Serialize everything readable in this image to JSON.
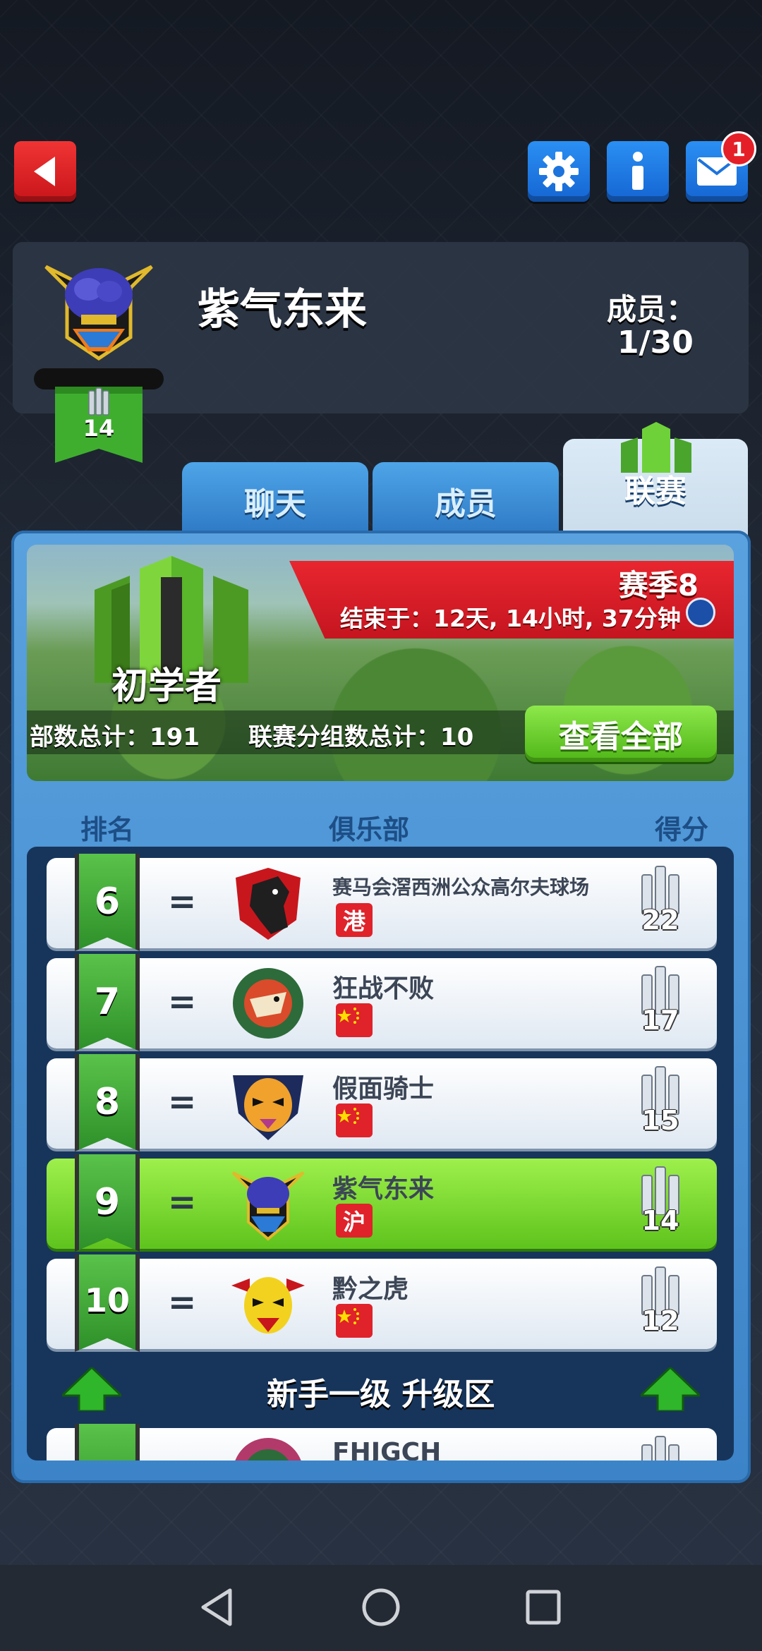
{
  "header": {
    "mail_count": "1"
  },
  "club": {
    "name": "紫气东来",
    "members_label": "成员：",
    "members_value": "1/30",
    "level": "14"
  },
  "tabs": [
    {
      "label": "聊天"
    },
    {
      "label": "成员"
    },
    {
      "label": "联赛"
    }
  ],
  "league": {
    "season": "赛季8",
    "ends_in": "结束于：12天, 14小时, 37分钟",
    "tier": "初学者",
    "clubs_total": "部数总计：191",
    "groups_total": "联赛分组数总计：10",
    "view_all": "查看全部"
  },
  "table": {
    "columns": [
      "排名",
      "俱乐部",
      "得分"
    ],
    "rows": [
      {
        "rank": "6",
        "change": "=",
        "name": "赛马会滘西洲公众高尔夫球场",
        "tag": "港",
        "score": "22"
      },
      {
        "rank": "7",
        "change": "=",
        "name": "狂战不败",
        "tag": "",
        "score": "17"
      },
      {
        "rank": "8",
        "change": "=",
        "name": "假面骑士",
        "tag": "",
        "score": "15"
      },
      {
        "rank": "9",
        "change": "=",
        "name": "紫气东来",
        "tag": "沪",
        "score": "14"
      },
      {
        "rank": "10",
        "change": "=",
        "name": "黔之虎",
        "tag": "",
        "score": "12"
      }
    ],
    "promotion_zone": "新手一级 升级区",
    "partial_row_name": "FHJGCH"
  },
  "colors": {
    "accent_green": "#5fc31d",
    "panel_blue": "#3c83c7",
    "season_red": "#e8262f"
  }
}
